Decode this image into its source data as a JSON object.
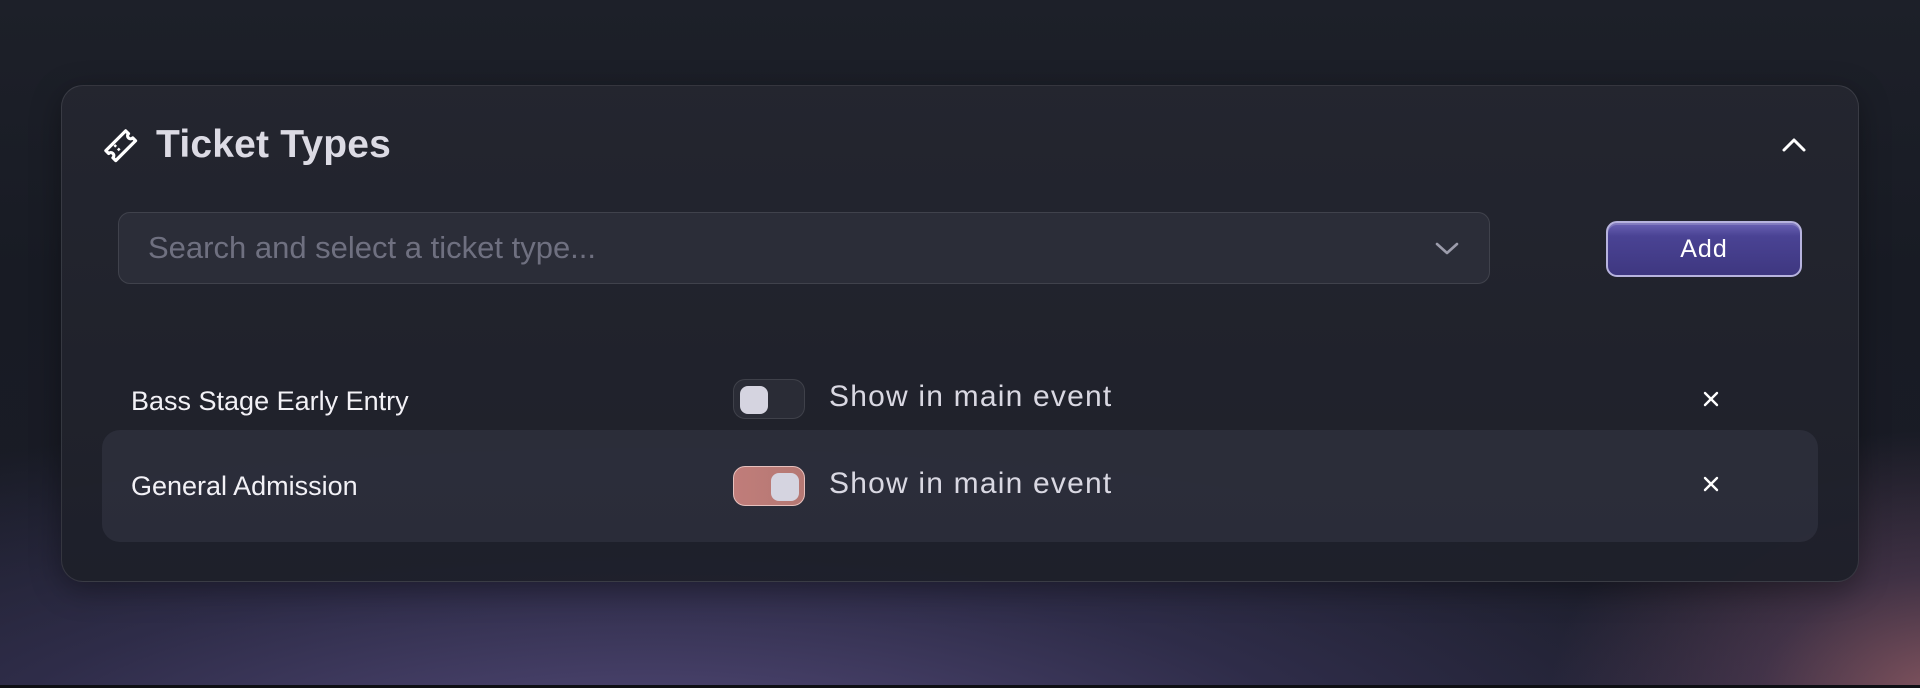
{
  "panel": {
    "title": "Ticket Types",
    "title_icon": "ticket-icon",
    "collapse_icon": "chevron-up-icon"
  },
  "search": {
    "placeholder": "Search and select a ticket type...",
    "value": "",
    "dropdown_icon": "chevron-down-icon"
  },
  "add_button": {
    "label": "Add"
  },
  "ticket_types": [
    {
      "name": "Bass Stage Early Entry",
      "toggle_label": "Show in main event",
      "show_in_main_event": false,
      "remove_icon": "close-icon"
    },
    {
      "name": "General Admission",
      "toggle_label": "Show in main event",
      "show_in_main_event": true,
      "remove_icon": "close-icon"
    }
  ],
  "colors": {
    "accent": "#4a4394",
    "toggle_on": "#c07d7a",
    "panel_bg": "#22242f"
  }
}
